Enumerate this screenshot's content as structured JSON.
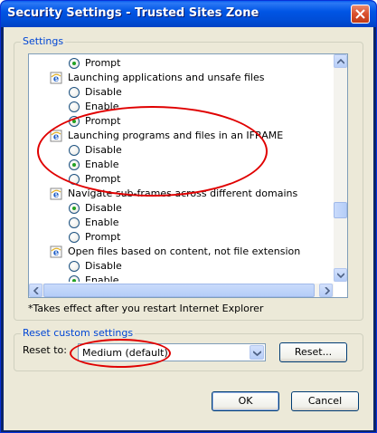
{
  "window": {
    "title": "Security Settings - Trusted Sites Zone"
  },
  "settings": {
    "group_label": "Settings",
    "list_rows": [
      {
        "kind": "option",
        "label": "Prompt",
        "checked": true
      },
      {
        "kind": "category",
        "label": "Launching applications and unsafe files"
      },
      {
        "kind": "option",
        "label": "Disable",
        "checked": false
      },
      {
        "kind": "option",
        "label": "Enable",
        "checked": false
      },
      {
        "kind": "option",
        "label": "Prompt",
        "checked": true
      },
      {
        "kind": "category",
        "label": "Launching programs and files in an IFRAME"
      },
      {
        "kind": "option",
        "label": "Disable",
        "checked": false
      },
      {
        "kind": "option",
        "label": "Enable",
        "checked": true
      },
      {
        "kind": "option",
        "label": "Prompt",
        "checked": false
      },
      {
        "kind": "category",
        "label": "Navigate sub-frames across different domains"
      },
      {
        "kind": "option",
        "label": "Disable",
        "checked": true
      },
      {
        "kind": "option",
        "label": "Enable",
        "checked": false
      },
      {
        "kind": "option",
        "label": "Prompt",
        "checked": false
      },
      {
        "kind": "category",
        "label": "Open files based on content, not file extension"
      },
      {
        "kind": "option",
        "label": "Disable",
        "checked": false
      },
      {
        "kind": "option",
        "label": "Enable",
        "checked": true
      }
    ],
    "note": "*Takes effect after you restart Internet Explorer"
  },
  "reset": {
    "group_label": "Reset custom settings",
    "reset_to_label": "Reset to:",
    "selected_level": "Medium (default)",
    "reset_button": "Reset..."
  },
  "buttons": {
    "ok": "OK",
    "cancel": "Cancel"
  },
  "icons": {
    "category": "ie-icon",
    "close": "close-icon"
  },
  "colors": {
    "accent": "#0046d5",
    "annotation": "#e00000",
    "radio_dot": "#21a121"
  }
}
